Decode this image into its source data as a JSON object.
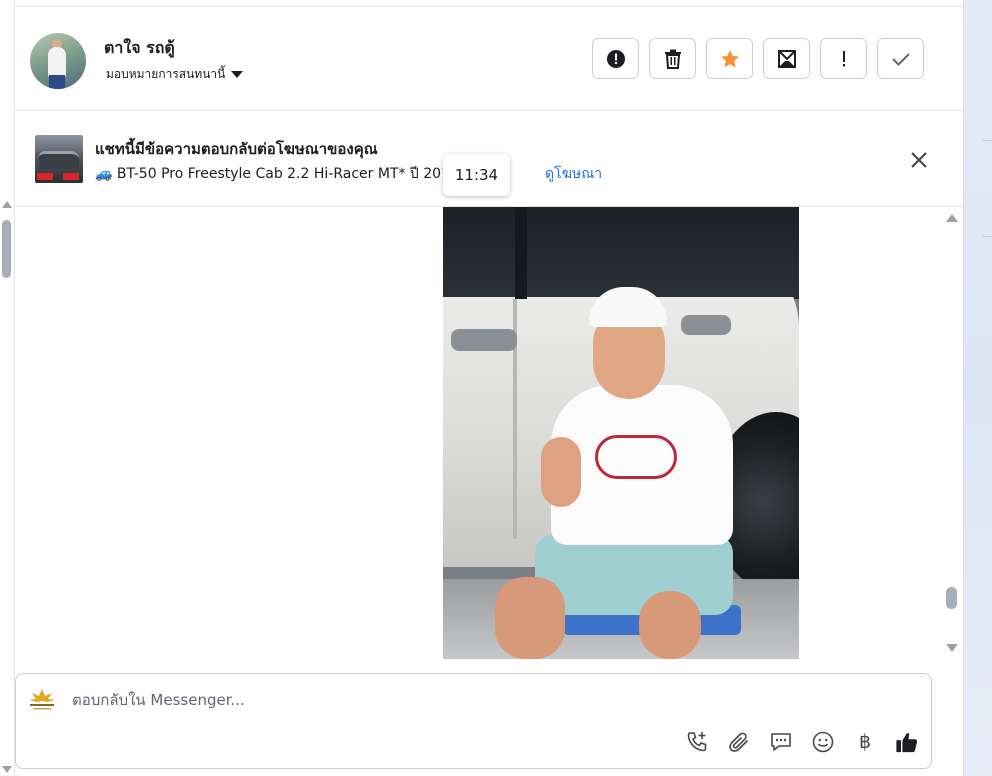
{
  "contact": {
    "name": "ตาใจ รถตู้",
    "assign_label": "มอบหมายการสนทนานี้"
  },
  "actions": [
    {
      "name": "spam-button",
      "icon": "alert-circle-icon"
    },
    {
      "name": "delete-button",
      "icon": "trash-icon"
    },
    {
      "name": "star-button",
      "icon": "star-icon",
      "color": "#f7923b"
    },
    {
      "name": "archive-button",
      "icon": "archive-mail-icon"
    },
    {
      "name": "follow-up-button",
      "icon": "exclamation-icon"
    },
    {
      "name": "done-button",
      "icon": "checkmark-icon"
    }
  ],
  "ad_banner": {
    "title": "แชทนี้มีข้อความตอบกลับต่อโฆษณาของคุณ",
    "subtitle": "🚙 BT-50 Pro Freestyle Cab 2.2 Hi-Racer MT* ปี 2014 ... 4 ...",
    "link_label": "ดูโฆษณา"
  },
  "message": {
    "timestamp": "11:34"
  },
  "composer": {
    "placeholder": "ตอบกลับใน Messenger...",
    "currency_symbol": "฿"
  },
  "colors": {
    "accent_link": "#216fdb",
    "star": "#f7923b",
    "border": "#ccd0d5"
  }
}
